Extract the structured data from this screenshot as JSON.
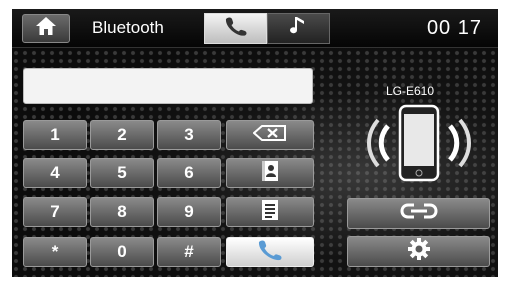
{
  "header": {
    "title": "Bluetooth",
    "clock": "00 17",
    "home_icon": "home-icon",
    "tabs": [
      {
        "icon": "phone-handset-icon",
        "active": true
      },
      {
        "icon": "music-note-icon",
        "active": false
      }
    ]
  },
  "dialer": {
    "number_value": "",
    "keys": [
      "1",
      "2",
      "3",
      "4",
      "5",
      "6",
      "7",
      "8",
      "9",
      "*",
      "0",
      "#"
    ],
    "backspace_icon": "backspace-icon",
    "contacts_icon": "contacts-book-icon",
    "call_log_icon": "call-log-icon",
    "call_icon": "phone-handset-icon"
  },
  "device": {
    "name": "LG-E610",
    "icon": "smartphone-signal-icon",
    "link_icon": "link-icon",
    "settings_icon": "gear-icon"
  },
  "colors": {
    "background": "#0c0c0c",
    "key_gradient_top": "#8a8a8a",
    "key_gradient_bottom": "#4b4b4b",
    "active_tab": "#e8e8e8"
  }
}
